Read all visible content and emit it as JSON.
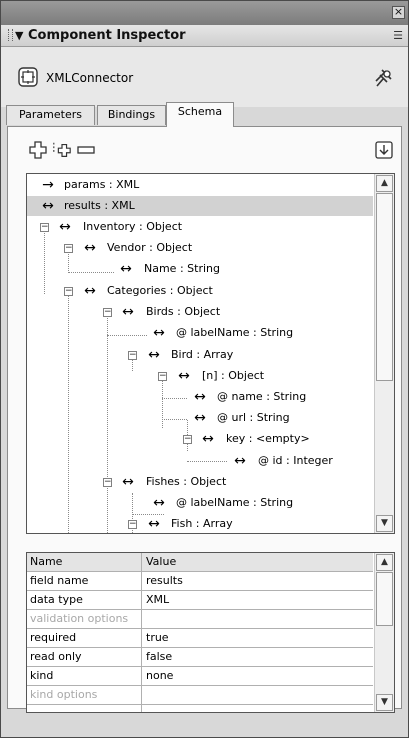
{
  "panel": {
    "title": "Component Inspector",
    "component_name": "XMLConnector"
  },
  "tabs": [
    {
      "label": "Parameters"
    },
    {
      "label": "Bindings"
    },
    {
      "label": "Schema",
      "active": true
    }
  ],
  "toolbar": {
    "icons": [
      "add-field-icon",
      "add-child-field-icon",
      "delete-field-icon",
      "import-schema-icon"
    ]
  },
  "tree": {
    "rows": [
      {
        "label": "params : XML",
        "arrow": "→"
      },
      {
        "label": "results : XML",
        "arrow": "↔",
        "selected": true
      },
      {
        "label": "Inventory : Object",
        "arrow": "↔"
      },
      {
        "label": "Vendor : Object",
        "arrow": "↔"
      },
      {
        "label": "Name : String",
        "arrow": "↔"
      },
      {
        "label": "Categories : Object",
        "arrow": "↔"
      },
      {
        "label": "Birds : Object",
        "arrow": "↔"
      },
      {
        "label": "@ labelName : String",
        "arrow": "↔"
      },
      {
        "label": "Bird : Array",
        "arrow": "↔"
      },
      {
        "label": "[n] : Object",
        "arrow": "↔"
      },
      {
        "label": "@ name : String",
        "arrow": "↔"
      },
      {
        "label": "@ url : String",
        "arrow": "↔"
      },
      {
        "label": "key : <empty>",
        "arrow": "↔"
      },
      {
        "label": "@ id : Integer",
        "arrow": "↔"
      },
      {
        "label": "Fishes : Object",
        "arrow": "↔"
      },
      {
        "label": "@ labelName : String",
        "arrow": "↔"
      },
      {
        "label": "Fish : Array",
        "arrow": "↔"
      }
    ]
  },
  "properties": {
    "headers": {
      "name": "Name",
      "value": "Value"
    },
    "rows": [
      {
        "name": "field name",
        "value": "results",
        "disabled": false
      },
      {
        "name": "data type",
        "value": "XML",
        "disabled": false
      },
      {
        "name": "validation options",
        "value": "",
        "disabled": true
      },
      {
        "name": "required",
        "value": "true",
        "disabled": false
      },
      {
        "name": "read only",
        "value": "false",
        "disabled": false
      },
      {
        "name": "kind",
        "value": "none",
        "disabled": false
      },
      {
        "name": "kind options",
        "value": "",
        "disabled": true
      }
    ]
  }
}
